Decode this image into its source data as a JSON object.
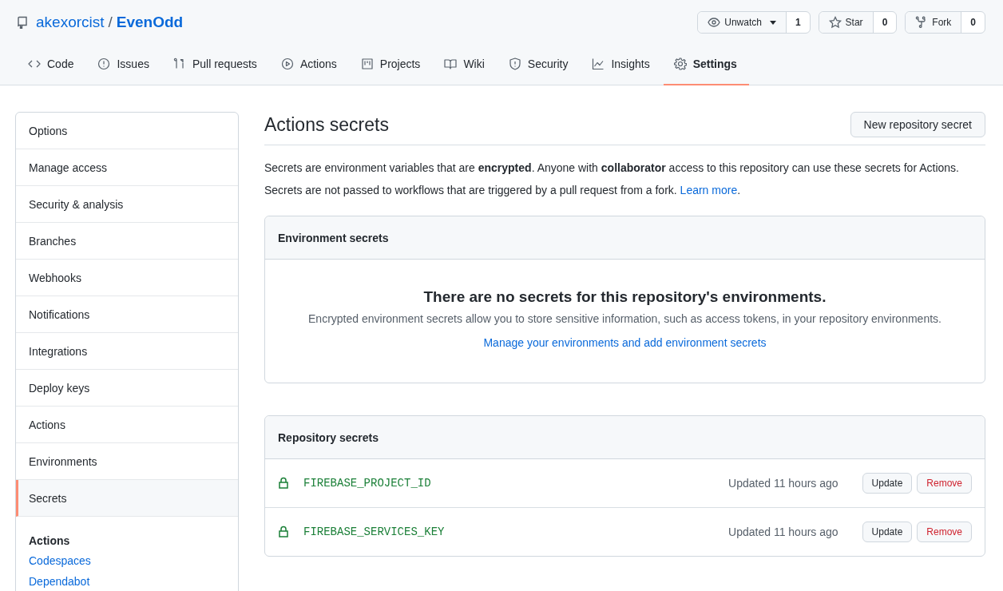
{
  "repo": {
    "owner": "akexorcist",
    "separator": "/",
    "name": "EvenOdd"
  },
  "repo_actions": [
    {
      "label": "Unwatch",
      "count": "1",
      "dropdown": true
    },
    {
      "label": "Star",
      "count": "0",
      "dropdown": false
    },
    {
      "label": "Fork",
      "count": "0",
      "dropdown": false
    }
  ],
  "tabs": [
    {
      "label": "Code",
      "selected": false
    },
    {
      "label": "Issues",
      "selected": false
    },
    {
      "label": "Pull requests",
      "selected": false
    },
    {
      "label": "Actions",
      "selected": false
    },
    {
      "label": "Projects",
      "selected": false
    },
    {
      "label": "Wiki",
      "selected": false
    },
    {
      "label": "Security",
      "selected": false
    },
    {
      "label": "Insights",
      "selected": false
    },
    {
      "label": "Settings",
      "selected": true
    }
  ],
  "sidebar": {
    "items": [
      {
        "label": "Options",
        "selected": false
      },
      {
        "label": "Manage access",
        "selected": false
      },
      {
        "label": "Security & analysis",
        "selected": false
      },
      {
        "label": "Branches",
        "selected": false
      },
      {
        "label": "Webhooks",
        "selected": false
      },
      {
        "label": "Notifications",
        "selected": false
      },
      {
        "label": "Integrations",
        "selected": false
      },
      {
        "label": "Deploy keys",
        "selected": false
      },
      {
        "label": "Actions",
        "selected": false
      },
      {
        "label": "Environments",
        "selected": false
      },
      {
        "label": "Secrets",
        "selected": true
      }
    ],
    "section_title": "Actions",
    "links": [
      "Codespaces",
      "Dependabot"
    ]
  },
  "page": {
    "title": "Actions secrets",
    "new_button": "New repository secret",
    "description": "Secrets are environment variables that are **encrypted**. Anyone with **collaborator** access to this repository can use these secrets for Actions.",
    "note": {
      "text": "Secrets are not passed to workflows that are triggered by a pull request from a fork.",
      "link": "Learn more",
      "suffix": "."
    }
  },
  "environment_secrets": {
    "title": "Environment secrets",
    "empty_title": "There are no secrets for this repository's environments.",
    "empty_text": "Encrypted environment secrets allow you to store sensitive information, such as access tokens, in your repository environments.",
    "link": "Manage your environments and add environment secrets"
  },
  "repository_secrets": {
    "title": "Repository secrets",
    "rows": [
      {
        "name": "FIREBASE_PROJECT_ID",
        "updated": "Updated 11 hours ago",
        "update_button": "Update",
        "remove_button": "Remove"
      },
      {
        "name": "FIREBASE_SERVICES_KEY",
        "updated": "Updated 11 hours ago",
        "update_button": "Update",
        "remove_button": "Remove"
      }
    ]
  }
}
